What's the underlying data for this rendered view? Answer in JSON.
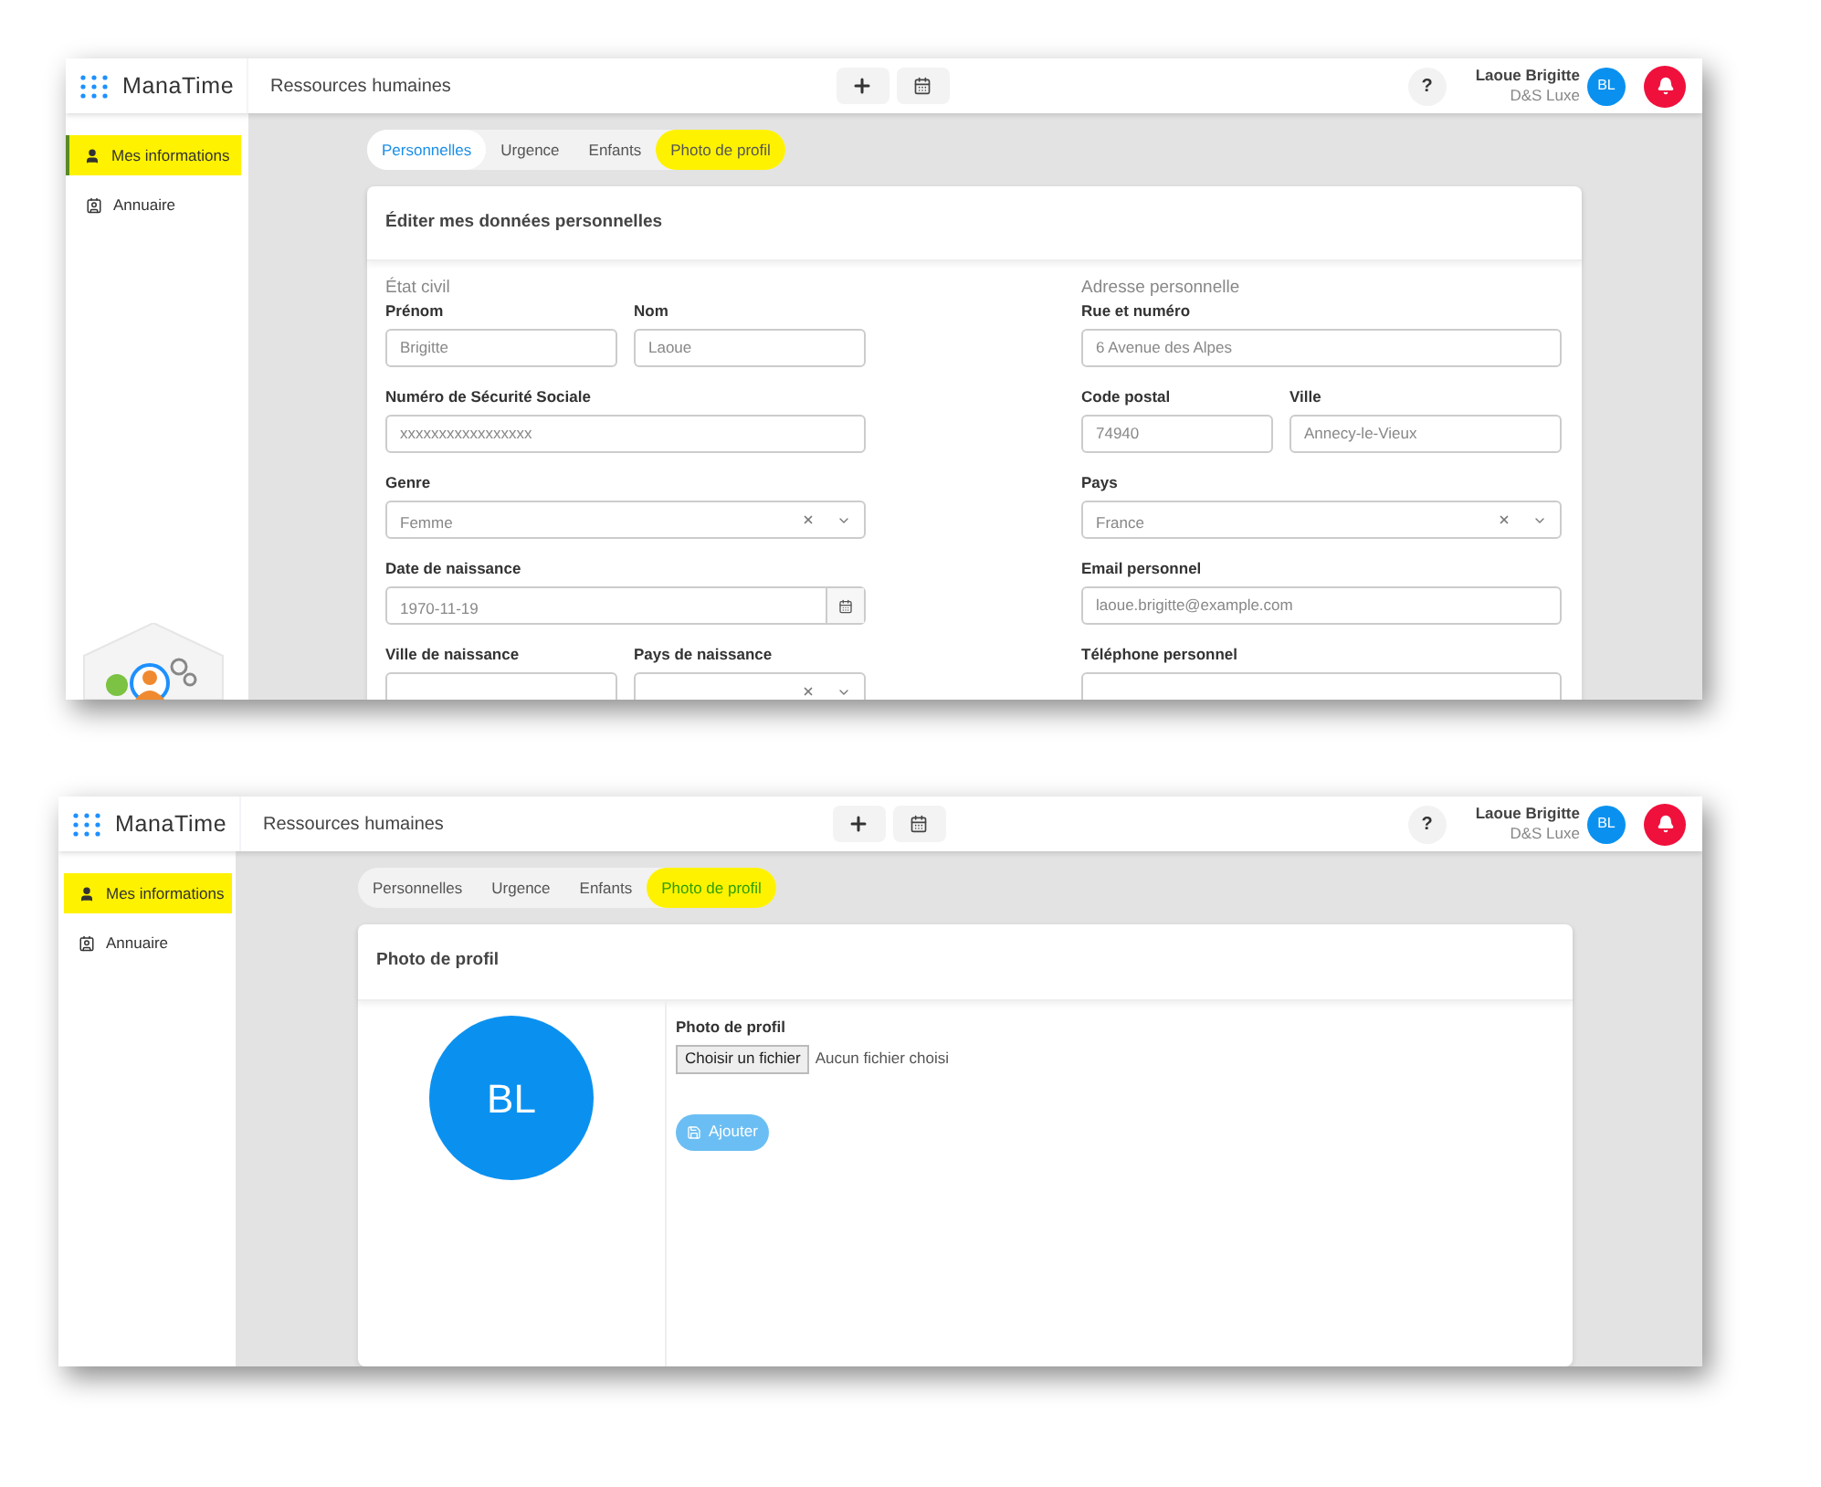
{
  "screens": [
    {
      "kind": "personal",
      "header": {
        "logo": "ManaTime",
        "section": "Ressources humaines",
        "user_name": "Laoue Brigitte",
        "company": "D&S Luxe",
        "avatar_initials": "BL",
        "help": "?"
      },
      "sidebar": [
        {
          "label": "Mes informations",
          "selected": true,
          "highlighted": true
        },
        {
          "label": "Annuaire",
          "selected": false,
          "highlighted": false
        }
      ],
      "tabs": [
        {
          "label": "Personnelles",
          "selected": true,
          "highlighted": false
        },
        {
          "label": "Urgence",
          "selected": false,
          "highlighted": false
        },
        {
          "label": "Enfants",
          "selected": false,
          "highlighted": false
        },
        {
          "label": "Photo de profil",
          "selected": false,
          "highlighted": true
        }
      ],
      "card": {
        "title": "Éditer mes données personnelles",
        "columns": [
          {
            "heading": "État civil",
            "rows": [
              [
                {
                  "label": "Prénom",
                  "kind": "text",
                  "value": "Brigitte"
                },
                {
                  "label": "Nom",
                  "kind": "text",
                  "value": "Laoue"
                }
              ],
              [
                {
                  "label": "Numéro de Sécurité Sociale",
                  "kind": "text",
                  "value": "xxxxxxxxxxxxxxxxx"
                }
              ],
              [
                {
                  "label": "Genre",
                  "kind": "select",
                  "value": "Femme"
                }
              ],
              [
                {
                  "label": "Date de naissance",
                  "kind": "date",
                  "value": "1970-11-19"
                }
              ],
              [
                {
                  "label": "Ville de naissance",
                  "kind": "text"
                },
                {
                  "label": "Pays de naissance",
                  "kind": "select"
                }
              ]
            ]
          },
          {
            "heading": "Adresse personnelle",
            "rows": [
              [
                {
                  "label": "Rue et numéro",
                  "kind": "text",
                  "value": "6 Avenue des Alpes"
                }
              ],
              [
                {
                  "label": "Code postal",
                  "kind": "text",
                  "value": "74940"
                },
                {
                  "label": "Ville",
                  "kind": "text",
                  "value": "Annecy-le-Vieux"
                }
              ],
              [
                {
                  "label": "Pays",
                  "kind": "select",
                  "value": "France"
                }
              ],
              [
                {
                  "label": "Email personnel",
                  "kind": "text",
                  "value": "laoue.brigitte@example.com"
                }
              ],
              [
                {
                  "label": "Téléphone personnel",
                  "kind": "text"
                }
              ]
            ]
          }
        ]
      }
    },
    {
      "kind": "photo",
      "header": {
        "logo": "ManaTime",
        "section": "Ressources humaines",
        "user_name": "Laoue Brigitte",
        "company": "D&S Luxe",
        "avatar_initials": "BL",
        "help": "?"
      },
      "sidebar": [
        {
          "label": "Mes informations",
          "selected": false,
          "highlighted": true
        },
        {
          "label": "Annuaire",
          "selected": false,
          "highlighted": false
        }
      ],
      "tabs": [
        {
          "label": "Personnelles",
          "selected": false,
          "highlighted": false
        },
        {
          "label": "Urgence",
          "selected": false,
          "highlighted": false
        },
        {
          "label": "Enfants",
          "selected": false,
          "highlighted": false
        },
        {
          "label": "Photo de profil",
          "selected": true,
          "highlighted": true
        }
      ],
      "card": {
        "title": "Photo de profil",
        "avatar_initials": "BL",
        "upload_label": "Photo de profil",
        "file_button": "Choisir un fichier",
        "file_status": "Aucun fichier choisi",
        "add_button": "Ajouter"
      }
    }
  ]
}
